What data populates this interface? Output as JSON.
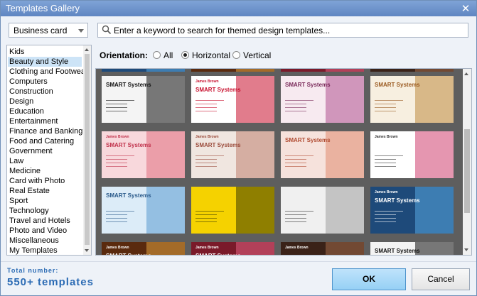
{
  "window": {
    "title": "Templates Gallery",
    "close_glyph": "✕"
  },
  "category_combo": {
    "value": "Business card"
  },
  "categories": [
    {
      "label": "Kids"
    },
    {
      "label": "Beauty and Style",
      "selected": true
    },
    {
      "label": "Clothing and Footwear"
    },
    {
      "label": "Computers"
    },
    {
      "label": "Construction"
    },
    {
      "label": "Design"
    },
    {
      "label": "Education"
    },
    {
      "label": "Entertainment"
    },
    {
      "label": "Finance and Banking"
    },
    {
      "label": "Food and Catering"
    },
    {
      "label": "Government"
    },
    {
      "label": "Law"
    },
    {
      "label": "Medicine"
    },
    {
      "label": "Card with Photo"
    },
    {
      "label": "Real Estate"
    },
    {
      "label": "Sport"
    },
    {
      "label": "Technology"
    },
    {
      "label": "Travel and Hotels"
    },
    {
      "label": "Photo and Video"
    },
    {
      "label": "Miscellaneous"
    },
    {
      "label": "My Templates"
    }
  ],
  "search": {
    "placeholder": "Enter a keyword to search for themed design templates..."
  },
  "orientation": {
    "label": "Orientation:",
    "options": [
      {
        "label": "All",
        "checked": false
      },
      {
        "label": "Horizontal",
        "checked": true
      },
      {
        "label": "Vertical",
        "checked": false
      }
    ]
  },
  "templates": [
    {
      "name": "James Brown",
      "brand": "SMART Systems",
      "bg": "#1e4a7a",
      "accent": "#58a8e0",
      "text": "#ffffff"
    },
    {
      "name": "James Brown",
      "brand": "SMART Systems",
      "bg": "#5a2a0e",
      "accent": "#e0a040",
      "text": "#ffffff"
    },
    {
      "name": "James Brown",
      "brand": "SMART Systems",
      "bg": "#7a1a2a",
      "accent": "#e06080",
      "text": "#ffffff"
    },
    {
      "name": "James Brown",
      "brand": "",
      "bg": "#3a2218",
      "accent": "#a06a4a",
      "text": "#ffffff"
    },
    {
      "name": "",
      "brand": "SMART Systems",
      "bg": "#f4f4f4",
      "accent": "#111111",
      "text": "#111111"
    },
    {
      "name": "James Brown",
      "brand": "SMART Systems",
      "bg": "#ffffff",
      "accent": "#c8102e",
      "text": "#c8102e"
    },
    {
      "name": "",
      "brand": "SMART Systems",
      "bg": "#f7eaf0",
      "accent": "#b05090",
      "text": "#7a2a5a"
    },
    {
      "name": "",
      "brand": "SMART Systems",
      "bg": "#f7efe0",
      "accent": "#c08a40",
      "text": "#9a5a20"
    },
    {
      "name": "James Brown",
      "brand": "SMART Systems",
      "bg": "#f8d8dc",
      "accent": "#e07080",
      "text": "#c0304a"
    },
    {
      "name": "James Brown",
      "brand": "SMART Systems",
      "bg": "#f0e6e0",
      "accent": "#c08070",
      "text": "#9a4a3a"
    },
    {
      "name": "",
      "brand": "SMART Systems",
      "bg": "#f6e2dc",
      "accent": "#e08a70",
      "text": "#b04a30"
    },
    {
      "name": "James Brown",
      "brand": "",
      "bg": "#ffffff",
      "accent": "#d04070",
      "text": "#333333"
    },
    {
      "name": "",
      "brand": "SMART Systems",
      "bg": "#dcecf8",
      "accent": "#5a9ad0",
      "text": "#2a5a8a"
    },
    {
      "name": "",
      "brand": "",
      "bg": "#f5d200",
      "accent": "#3a3a00",
      "text": "#3a3a00"
    },
    {
      "name": "",
      "brand": "",
      "bg": "#f0f0f0",
      "accent": "#a0a0a0",
      "text": "#333333"
    }
  ],
  "footer": {
    "total_label": "Total number:",
    "total_value": "550+ templates",
    "ok_label": "OK",
    "cancel_label": "Cancel"
  },
  "colors": {
    "title_bar": "#6a90c8",
    "accent_text": "#2b6bb4",
    "ok_button": "#a9daf8"
  }
}
